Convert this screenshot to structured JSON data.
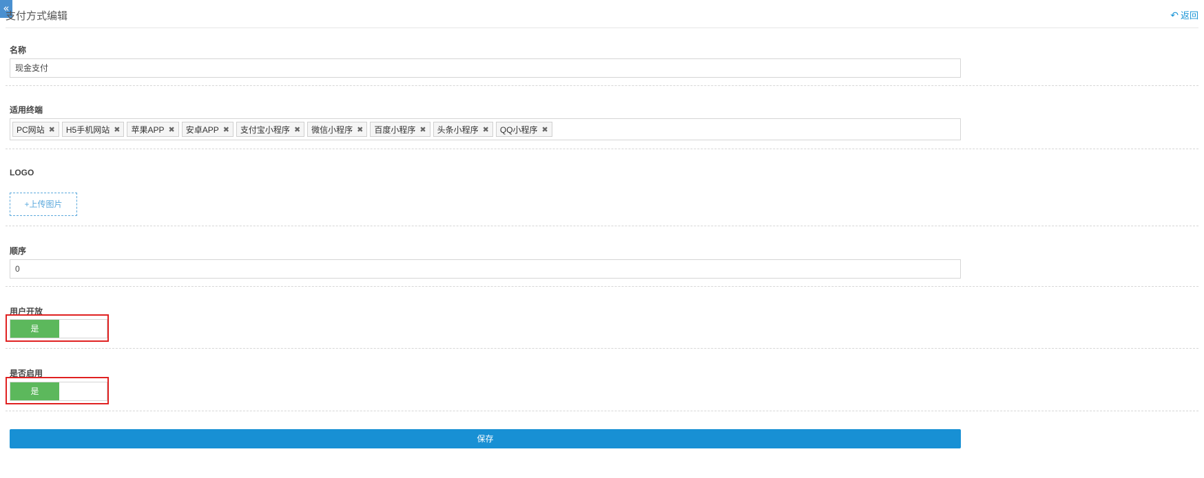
{
  "header": {
    "title": "支付方式编辑",
    "back_label": "返回"
  },
  "form": {
    "name": {
      "label": "名称",
      "value": "现金支付"
    },
    "terminals": {
      "label": "适用终端",
      "tags": [
        "PC网站",
        "H5手机网站",
        "苹果APP",
        "安卓APP",
        "支付宝小程序",
        "微信小程序",
        "百度小程序",
        "头条小程序",
        "QQ小程序"
      ]
    },
    "logo": {
      "label": "LOGO",
      "upload_label": "+上传图片"
    },
    "order": {
      "label": "顺序",
      "value": "0"
    },
    "user_open": {
      "label": "用户开放",
      "toggle_label": "是"
    },
    "enabled": {
      "label": "是否启用",
      "toggle_label": "是"
    },
    "save_label": "保存"
  },
  "colors": {
    "accent": "#1890d4",
    "toggle_on": "#5cb85c",
    "highlight_border": "#e02020"
  }
}
